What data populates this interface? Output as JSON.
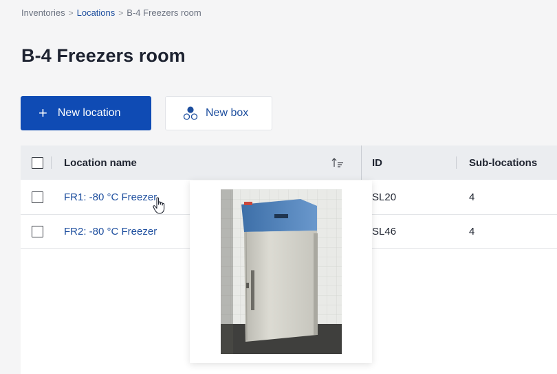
{
  "breadcrumb": {
    "items": [
      "Inventories",
      "Locations",
      "B-4 Freezers room"
    ],
    "separator": ">"
  },
  "page": {
    "title": "B-4 Freezers room"
  },
  "toolbar": {
    "new_location_label": "New location",
    "new_location_icon": "+",
    "new_box_label": "New box"
  },
  "table": {
    "columns": [
      "Location name",
      "ID",
      "Sub-locations"
    ],
    "rows": [
      {
        "name": "FR1: -80 °C Freezer",
        "id": "SL20",
        "sublocations": "4"
      },
      {
        "name": "FR2: -80 °C Freezer",
        "id": "SL46",
        "sublocations": "4"
      }
    ]
  },
  "preview": {
    "image": "freezer-photo"
  },
  "colors": {
    "primary": "#0f4bb4",
    "link": "#1d4e9e",
    "header_bg": "#ebedf0",
    "page_bg": "#f5f5f6"
  }
}
